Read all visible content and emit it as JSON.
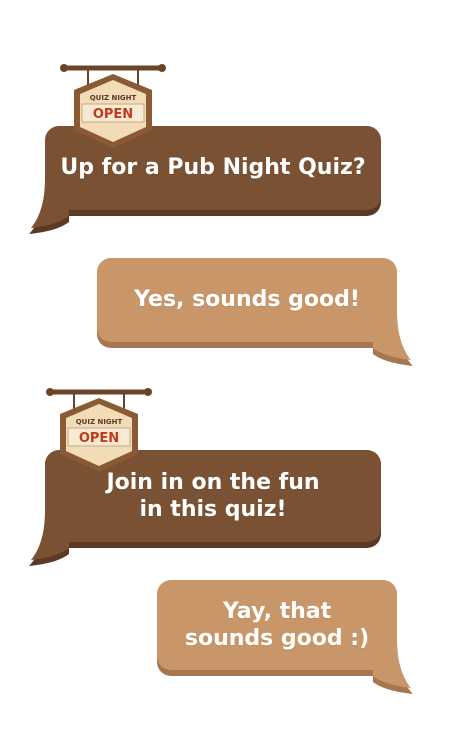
{
  "colors": {
    "dark_bubble": "#7a5133",
    "dark_bubble_shadow": "#5a3a24",
    "light_bubble": "#c89668",
    "light_bubble_shadow": "#a67650",
    "sign_plate": "#f2dcb8",
    "sign_frame": "#8a5a34",
    "open_text": "#c23a1e"
  },
  "messages": [
    {
      "text": "Up for a Pub Night Quiz?",
      "style": "dark",
      "sign": true
    },
    {
      "text": "Yes, sounds good!",
      "style": "light",
      "sign": false
    },
    {
      "text": "Join in on the fun\nin this quiz!",
      "style": "dark",
      "sign": true
    },
    {
      "text": "Yay, that\nsounds good :)",
      "style": "light",
      "sign": false
    }
  ],
  "sign": {
    "top_label": "QUIZ NIGHT",
    "main_label": "OPEN"
  }
}
